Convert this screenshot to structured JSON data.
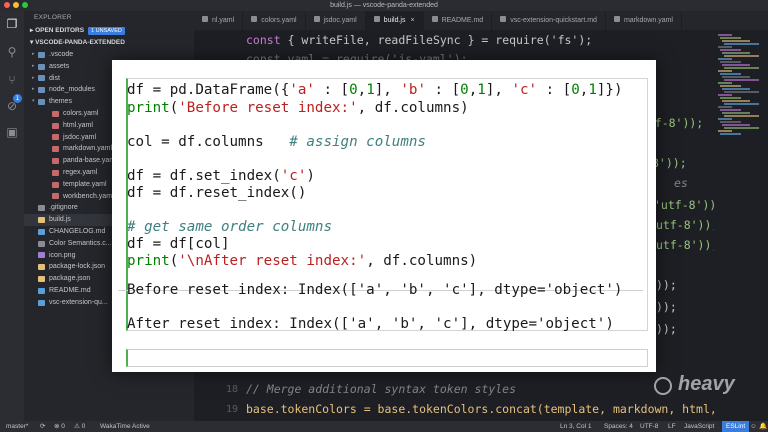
{
  "window": {
    "title": "build.js — vscode-panda-extended"
  },
  "activity_bar": {
    "icons": [
      "files-icon",
      "search-icon",
      "source-control-icon",
      "debug-icon",
      "extensions-icon"
    ],
    "scm_badge": "1"
  },
  "sidebar": {
    "header": "EXPLORER",
    "open_editors": {
      "label": "OPEN EDITORS",
      "badge": "1 UNSAVED"
    },
    "project": "VSCODE-PANDA-EXTENDED",
    "tree": [
      {
        "label": ".vscode",
        "type": "folder",
        "color": "#6b8fb8"
      },
      {
        "label": "assets",
        "type": "folder",
        "color": "#6b8fb8"
      },
      {
        "label": "dist",
        "type": "folder",
        "color": "#6b8fb8"
      },
      {
        "label": "node_modules",
        "type": "folder",
        "color": "#6b8fb8"
      },
      {
        "label": "themes",
        "type": "folder",
        "color": "#6b8fb8"
      },
      {
        "label": "colors.yaml",
        "type": "file",
        "color": "#c46a6a"
      },
      {
        "label": "html.yaml",
        "type": "file",
        "color": "#c46a6a"
      },
      {
        "label": "jsdoc.yaml",
        "type": "file",
        "color": "#c46a6a"
      },
      {
        "label": "markdown.yaml",
        "type": "file",
        "color": "#c46a6a"
      },
      {
        "label": "panda-base.yaml",
        "type": "file",
        "color": "#c46a6a"
      },
      {
        "label": "regex.yaml",
        "type": "file",
        "color": "#c46a6a"
      },
      {
        "label": "template.yaml",
        "type": "file",
        "color": "#c46a6a"
      },
      {
        "label": "workbench.yaml",
        "type": "file",
        "color": "#c46a6a"
      },
      {
        "label": ".gitignore",
        "type": "file",
        "color": "#8b8c92"
      },
      {
        "label": "build.js",
        "type": "file",
        "color": "#e5c07b"
      },
      {
        "label": "CHANGELOG.md",
        "type": "file",
        "color": "#5aa0d8"
      },
      {
        "label": "Color Semantics.c...",
        "type": "file",
        "color": "#8b8c92"
      },
      {
        "label": "icon.png",
        "type": "file",
        "color": "#9f7fd0"
      },
      {
        "label": "package-lock.json",
        "type": "file",
        "color": "#e5c07b"
      },
      {
        "label": "package.json",
        "type": "file",
        "color": "#e5c07b"
      },
      {
        "label": "README.md",
        "type": "file",
        "color": "#5aa0d8"
      },
      {
        "label": "vsc-extension-qu...",
        "type": "file",
        "color": "#5aa0d8"
      }
    ]
  },
  "tabs": [
    {
      "label": "nl.yaml",
      "active": false
    },
    {
      "label": "colors.yaml",
      "active": false
    },
    {
      "label": "jsdoc.yaml",
      "active": false
    },
    {
      "label": "build.js",
      "active": true
    },
    {
      "label": "README.md",
      "active": false
    },
    {
      "label": "vsc-extension-quickstart.md",
      "active": false
    },
    {
      "label": "markdown.yaml",
      "active": false
    }
  ],
  "editor": {
    "line1": "const { writeFile, readFileSync } = require('fs');",
    "line2": "const yaml = require('js-yaml');",
    "right_fragments": [
      "'utf-8'));",
      "8'));",
      "es",
      "'utf-8'));",
      "utf-8'));",
      "utf-8'));",
      "));",
      "));",
      "));"
    ],
    "ln18": "18",
    "ln19": "19",
    "comment18": "// Merge additional syntax token styles",
    "line19": "base.tokenColors = base.tokenColors.concat(template, markdown, html, regex, jsdo"
  },
  "notebook": {
    "lines": [
      "df = pd.DataFrame({'a' : [0,1], 'b' : [0,1], 'c' : [0,1]})",
      "print('Before reset index:', df.columns)",
      "",
      "col = df.columns   # assign columns",
      "",
      "df = df.set_index('c')",
      "df = df.reset_index()",
      "",
      "# get same order columns",
      "df = df[col]",
      "print('\\nAfter reset index:', df.columns)"
    ],
    "output1": "Before reset index: Index(['a', 'b', 'c'], dtype='object')",
    "output2": "After reset index: Index(['a', 'b', 'c'], dtype='object')"
  },
  "watermark": "heavy",
  "status_bar": {
    "branch": "master*",
    "sync": "⟳",
    "errors": "⊗ 0",
    "warnings": "⚠ 0",
    "wakatime": "WakaTime Active",
    "position": "Ln 3, Col 1",
    "spaces": "Spaces: 4",
    "encoding": "UTF-8",
    "eol": "LF",
    "language": "JavaScript",
    "eslint": "ESLint",
    "smiley": "☺",
    "bell": "🔔"
  },
  "colors": {
    "editor_bg": "#1e1f24",
    "accent": "#3b7ddd",
    "cell_border": "#4caf50"
  }
}
